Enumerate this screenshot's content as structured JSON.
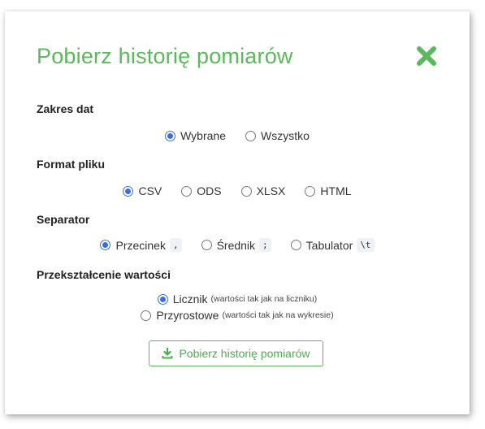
{
  "dialog": {
    "title": "Pobierz historię pomiarów",
    "close_icon": "close-x-icon",
    "accent_color": "#5cb85c"
  },
  "date_range": {
    "label": "Zakres dat",
    "options": [
      {
        "label": "Wybrane",
        "checked": true
      },
      {
        "label": "Wszystko",
        "checked": false
      }
    ]
  },
  "file_format": {
    "label": "Format pliku",
    "options": [
      {
        "label": "CSV",
        "checked": true
      },
      {
        "label": "ODS",
        "checked": false
      },
      {
        "label": "XLSX",
        "checked": false
      },
      {
        "label": "HTML",
        "checked": false
      }
    ]
  },
  "separator": {
    "label": "Separator",
    "options": [
      {
        "label": "Przecinek",
        "code": ",",
        "checked": true
      },
      {
        "label": "Średnik",
        "code": ";",
        "checked": false
      },
      {
        "label": "Tabulator",
        "code": "\\t",
        "checked": false
      }
    ]
  },
  "transform": {
    "label": "Przekształcenie wartości",
    "options": [
      {
        "label": "Licznik",
        "hint": "(wartości tak jak na liczniku)",
        "checked": true
      },
      {
        "label": "Przyrostowe",
        "hint": "(wartości tak jak na wykresie)",
        "checked": false
      }
    ]
  },
  "download_button": {
    "label": "Pobierz historię pomiarów",
    "icon": "download-icon"
  }
}
